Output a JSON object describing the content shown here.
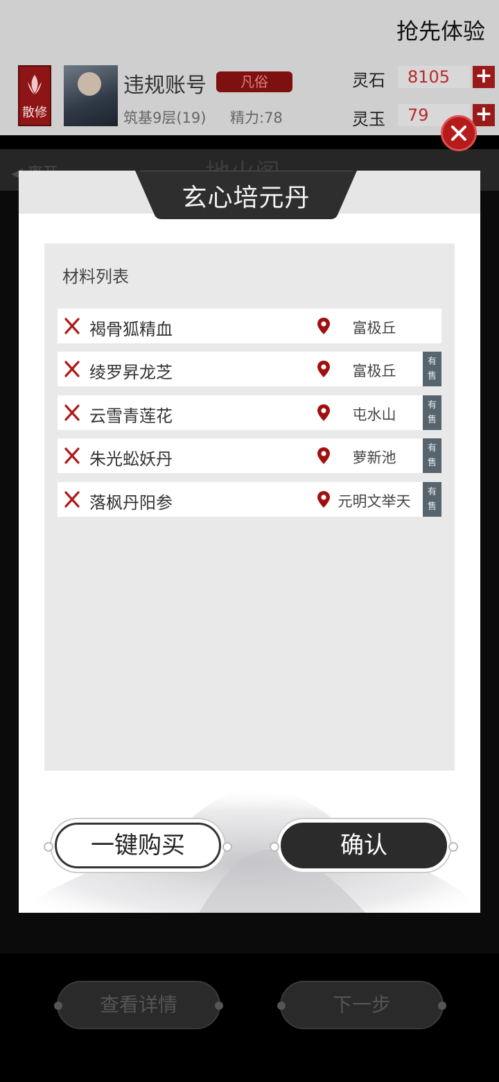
{
  "background": {
    "promo_label": "抢先体验",
    "faction_label": "散修",
    "user_name": "违规账号",
    "rank_badge": "凡俗",
    "realm": "筑基9层(19)",
    "energy": "精力:78",
    "resources": [
      {
        "label": "灵石",
        "value": "8105"
      },
      {
        "label": "灵玉",
        "value": "79"
      }
    ],
    "nav_back_label": "离开",
    "nav_title": "地火阁",
    "buttons": [
      "查看详情",
      "下一步"
    ]
  },
  "dialog": {
    "title": "玄心培元丹",
    "panel_label": "材料列表",
    "materials": [
      {
        "name": "褐骨狐精血",
        "location": "富极丘",
        "sale": ""
      },
      {
        "name": "绫罗昇龙芝",
        "location": "富极丘",
        "sale": "有售"
      },
      {
        "name": "云雪青莲花",
        "location": "屯水山",
        "sale": "有售"
      },
      {
        "name": "朱光蚣妖丹",
        "location": "萝新池",
        "sale": "有售"
      },
      {
        "name": "落枫丹阳参",
        "location": "元明文举天",
        "sale": "有售"
      }
    ],
    "buy_all_label": "一键购买",
    "confirm_label": "确认"
  },
  "colors": {
    "accent_red": "#9a1a1a",
    "sale_badge": "#56646e",
    "title_plate": "#2e2e2e"
  }
}
